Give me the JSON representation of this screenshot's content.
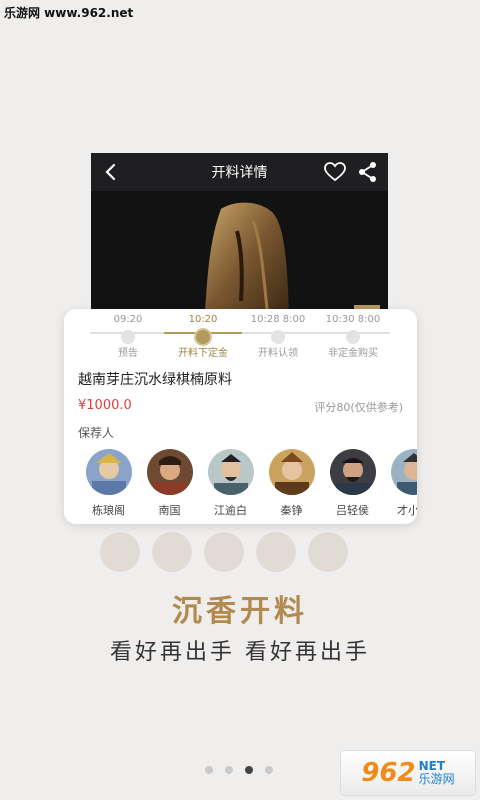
{
  "watermark": "乐游网 www.962.net",
  "phone": {
    "title": "开料详情",
    "icons": [
      "back-chevron-icon",
      "heart-icon",
      "share-icon"
    ]
  },
  "timeline": [
    {
      "time": "09:20",
      "label": "预告",
      "active": false
    },
    {
      "time": "10:20",
      "label": "开料下定金",
      "active": true
    },
    {
      "time": "10:28 8:00",
      "label": "开料认领",
      "active": false
    },
    {
      "time": "10:30 8:00",
      "label": "非定金购买",
      "active": false
    }
  ],
  "product": {
    "title": "越南芽庄沉水绿棋楠原料",
    "price": "¥1000.0",
    "score": "评分80(仅供参考)"
  },
  "recommenders": {
    "label": "保荐人",
    "people": [
      {
        "name": "栋琅阁"
      },
      {
        "name": "南国"
      },
      {
        "name": "江逾白"
      },
      {
        "name": "秦铮"
      },
      {
        "name": "吕轻侯"
      },
      {
        "name": "才小川"
      }
    ]
  },
  "headline": "沉香开料",
  "subline": "看好再出手 看好再出手",
  "pager": {
    "count": 4,
    "active": 2
  },
  "logo": {
    "number": "962",
    "net": "NET",
    "cn": "乐游网"
  },
  "colors": {
    "gold": "#b59a5e",
    "price_red": "#e33b3b",
    "headline": "#b08a4f"
  }
}
